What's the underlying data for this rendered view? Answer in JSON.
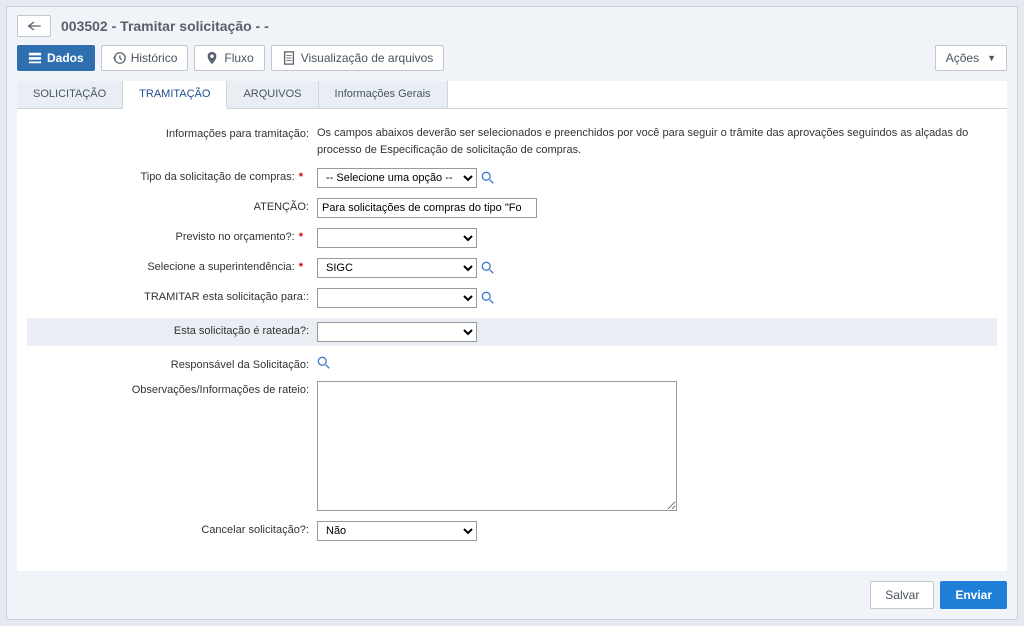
{
  "header": {
    "title": "003502 - Tramitar solicitação - -"
  },
  "toolbar": {
    "dados": "Dados",
    "historico": "Histórico",
    "fluxo": "Fluxo",
    "visualizacao": "Visualização de arquivos",
    "acoes": "Ações"
  },
  "tabs": {
    "solicitacao": "SOLICITAÇÃO",
    "tramitacao": "TRAMITAÇÃO",
    "arquivos": "ARQUIVOS",
    "info_gerais": "Informações Gerais"
  },
  "form": {
    "info_label": "Informações para tramitação:",
    "info_text": "Os campos abaixos deverão ser selecionados e preenchidos por você para seguir o trâmite das aprovações seguindos as alçadas do processo de Especificação de solicitação de compras.",
    "tipo_label": "Tipo da solicitação de compras:",
    "tipo_placeholder": "-- Selecione uma opção --",
    "atencao_label": "ATENÇÃO:",
    "atencao_value": "Para solicitações de compras do tipo \"Fo",
    "previsto_label": "Previsto no orçamento?:",
    "super_label": "Selecione a superintendência:",
    "super_value": "SIGC",
    "tramitar_label": "TRAMITAR esta solicitação para::",
    "rateada_label": "Esta solicitação é rateada?:",
    "responsavel_label": "Responsável da Solicitação:",
    "obs_label": "Observações/Informações de rateio:",
    "cancelar_label": "Cancelar solicitação?:",
    "cancelar_value": "Não"
  },
  "actions": {
    "save": "Salvar",
    "send": "Enviar"
  }
}
